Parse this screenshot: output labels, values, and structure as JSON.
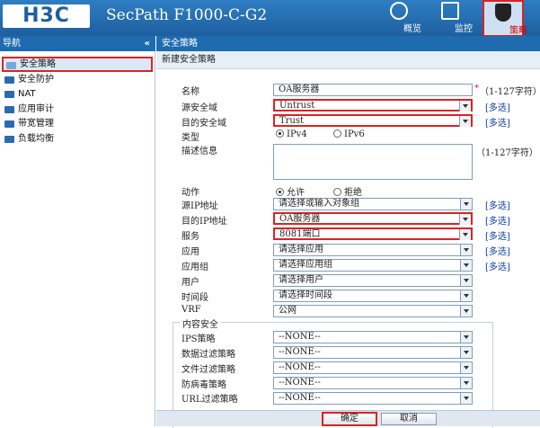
{
  "header": {
    "logo": "H3C",
    "product": "SecPath F1000-C-G2",
    "nav": [
      {
        "label": "概览",
        "icon": "gauge-icon"
      },
      {
        "label": "监控",
        "icon": "monitor-icon"
      },
      {
        "label": "策略",
        "icon": "shield-icon"
      }
    ]
  },
  "sidebar": {
    "title": "导航",
    "collapse": "«",
    "items": [
      {
        "label": "安全策略"
      },
      {
        "label": "安全防护"
      },
      {
        "label": "NAT"
      },
      {
        "label": "应用审计"
      },
      {
        "label": "带宽管理"
      },
      {
        "label": "负载均衡"
      }
    ]
  },
  "main": {
    "title": "安全策略",
    "subtitle": "新建安全策略"
  },
  "form": {
    "name_label": "名称",
    "name_value": "OA服务器",
    "name_req": "*",
    "name_hint": "（1-127字符）",
    "src_zone_label": "源安全域",
    "src_zone_value": "Untrust",
    "dst_zone_label": "目的安全域",
    "dst_zone_value": "Trust",
    "multi": "[多选]",
    "type_label": "类型",
    "type_opt1": "IPv4",
    "type_opt2": "IPv6",
    "desc_label": "描述信息",
    "desc_hint": "（1-127字符）",
    "action_label": "动作",
    "action_opt1": "允许",
    "action_opt2": "拒绝",
    "src_ip_label": "源IP地址",
    "src_ip_value": "请选择或输入对象组",
    "dst_ip_label": "目的IP地址",
    "dst_ip_value": "OA服务器",
    "service_label": "服务",
    "service_value": "8081端口",
    "app_label": "应用",
    "app_value": "请选择应用",
    "appgroup_label": "应用组",
    "appgroup_value": "请选择应用组",
    "user_label": "用户",
    "user_value": "请选择用户",
    "time_label": "时间段",
    "time_value": "请选择时间段",
    "vrf_label": "VRF",
    "vrf_value": "公网",
    "content_legend": "内容安全",
    "ips_label": "IPS策略",
    "ips_value": "--NONE--",
    "dlp_label": "数据过滤策略",
    "dlp_value": "--NONE--",
    "file_label": "文件过滤策略",
    "file_value": "--NONE--",
    "av_label": "防病毒策略",
    "av_value": "--NONE--",
    "url_label": "URL过滤策略",
    "url_value": "--NONE--"
  },
  "footer": {
    "ok": "确定",
    "cancel": "取消"
  }
}
